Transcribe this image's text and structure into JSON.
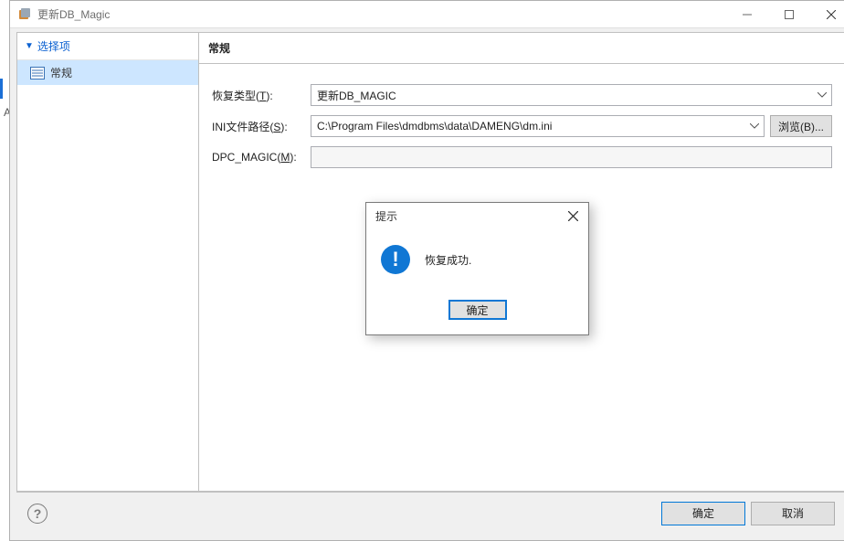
{
  "window": {
    "title": "更新DB_Magic"
  },
  "sidebar": {
    "section_title": "选择项",
    "items": [
      {
        "label": "常规",
        "selected": true
      }
    ]
  },
  "panel": {
    "title": "常规"
  },
  "form": {
    "recover_type": {
      "label_prefix": "恢复类型(",
      "mnemonic": "T",
      "label_suffix": "):",
      "value": "更新DB_MAGIC"
    },
    "ini_path": {
      "label_prefix": "INI文件路径(",
      "mnemonic": "S",
      "label_suffix": "):",
      "value": "C:\\Program Files\\dmdbms\\data\\DAMENG\\dm.ini",
      "browse_prefix": "浏览(",
      "browse_mnemonic": "B",
      "browse_suffix": ")..."
    },
    "dpc_magic": {
      "label_prefix": "DPC_MAGIC(",
      "mnemonic": "M",
      "label_suffix": "):",
      "value": ""
    }
  },
  "footer": {
    "ok": "确定",
    "cancel": "取消"
  },
  "modal": {
    "title": "提示",
    "message": "恢复成功.",
    "ok": "确定"
  },
  "ghost_letter": "A"
}
